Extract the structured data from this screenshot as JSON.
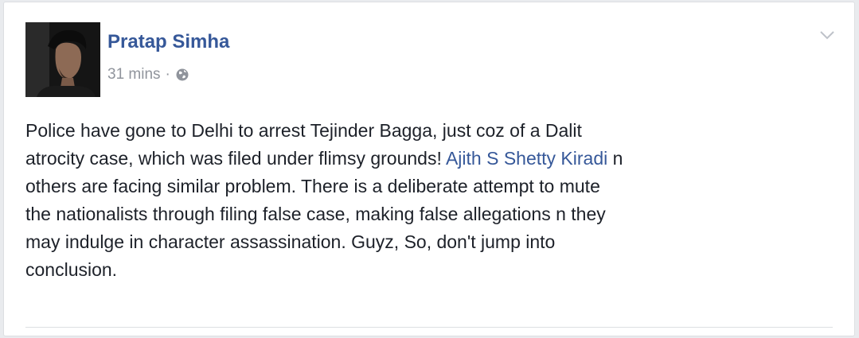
{
  "post": {
    "author": "Pratap Simha",
    "timestamp": "31 mins",
    "separator": "·",
    "privacy_icon": "globe-icon",
    "menu_icon": "chevron-down-icon",
    "lines": {
      "l1": "Police have gone to Delhi to arrest Tejinder Bagga, just coz of a Dalit",
      "l2a": "atrocity case, which was filed under flimsy grounds! ",
      "mention": "Ajith S Shetty Kiradi",
      "l2b": " n",
      "l3": "others are facing similar problem. There is a deliberate attempt to mute",
      "l4": "the nationalists through filing false case, making false allegations n they",
      "l5": "may indulge in character assassination. Guyz, So, don't jump into",
      "l6": "conclusion."
    }
  },
  "colors": {
    "link": "#365899",
    "text": "#1d2129",
    "meta": "#90949c"
  }
}
